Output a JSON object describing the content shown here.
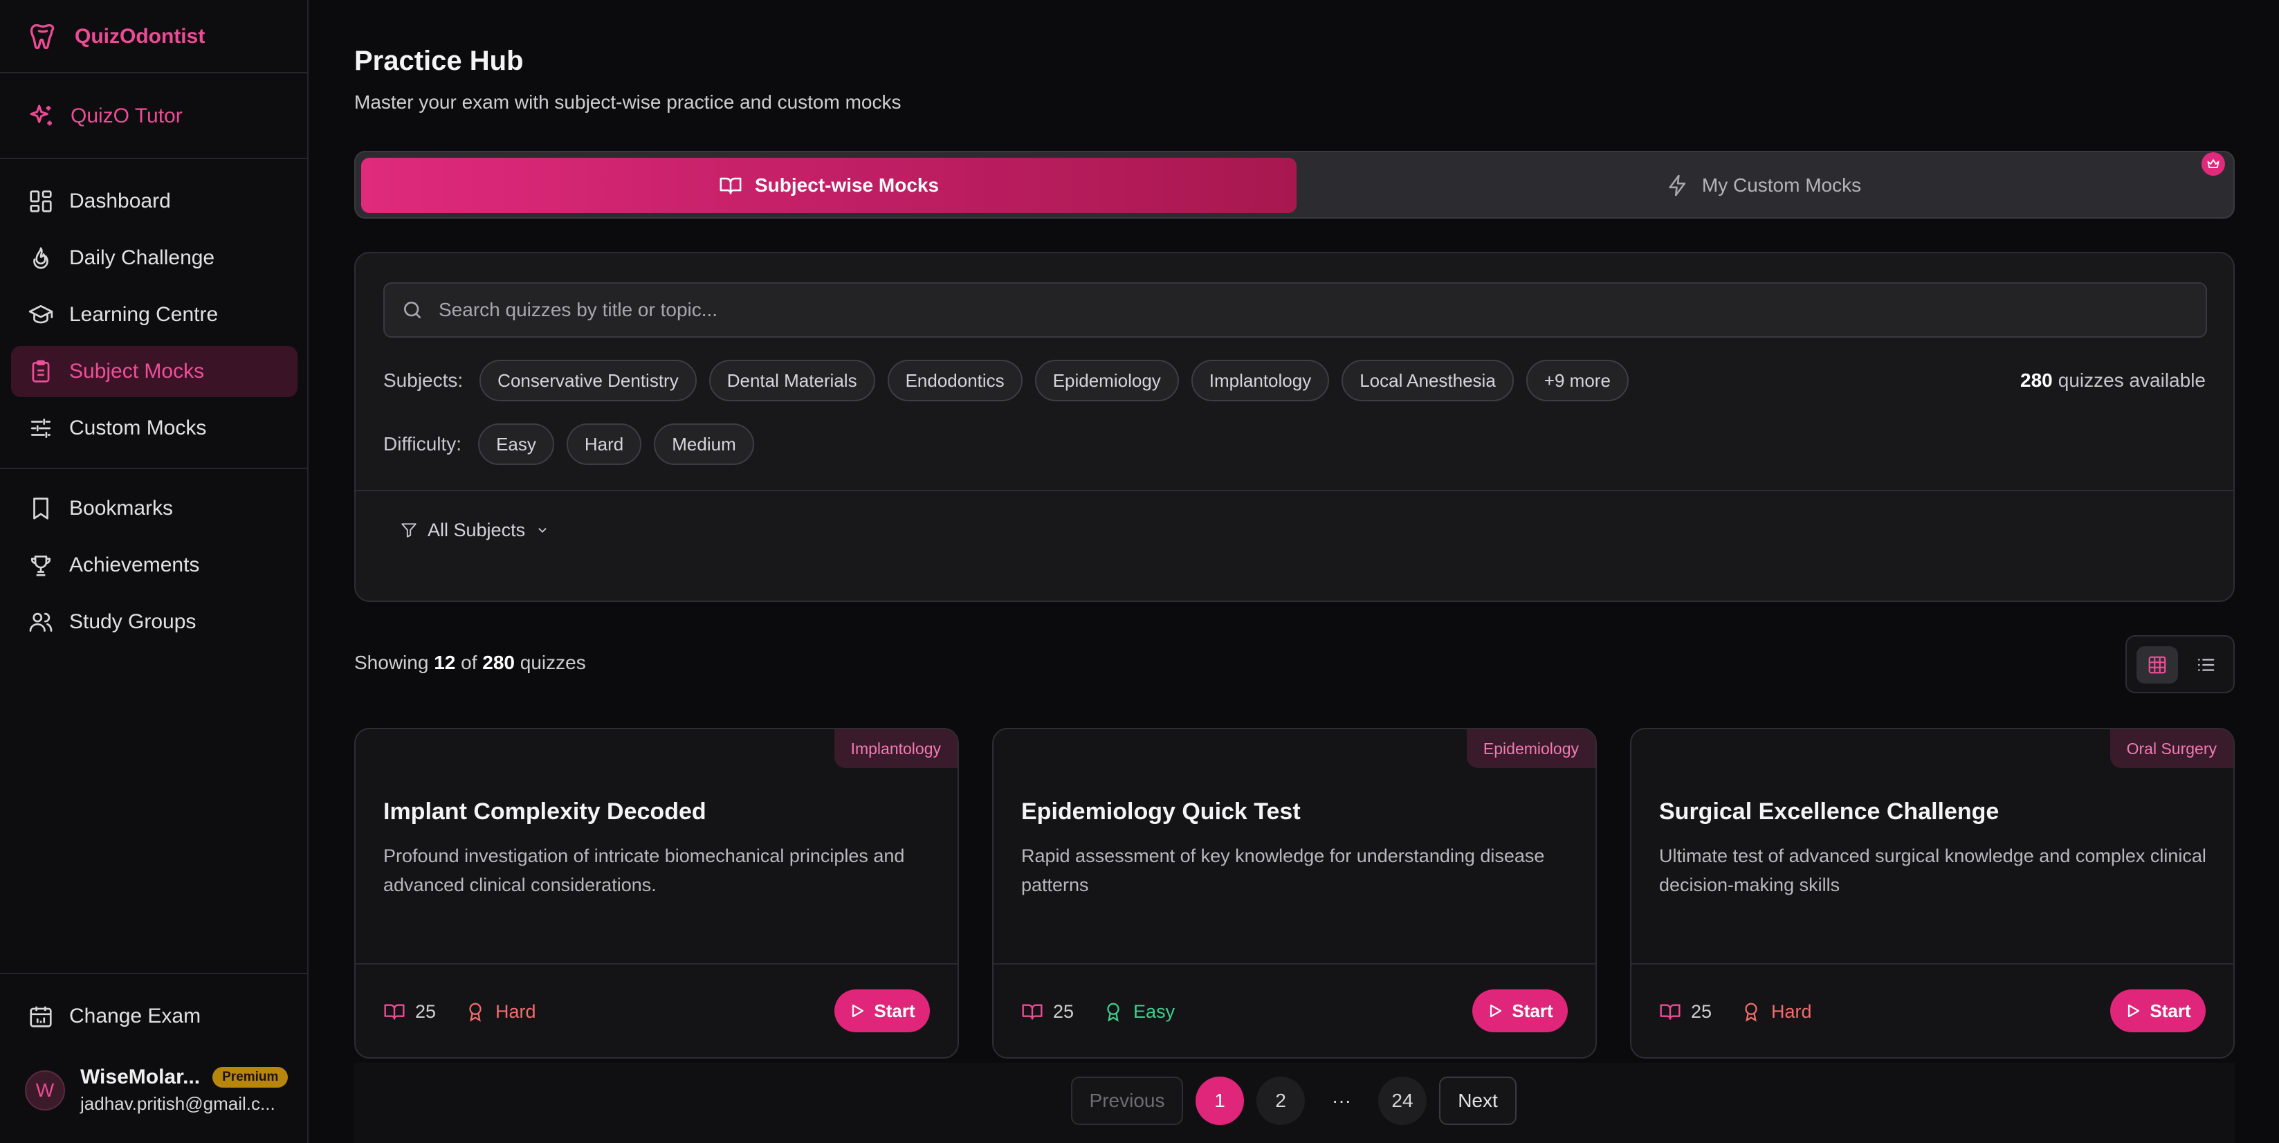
{
  "sidebar": {
    "brand": "QuizOdontist",
    "tutor": "QuizO Tutor",
    "nav_main": [
      {
        "label": "Dashboard",
        "icon": "dashboard-icon"
      },
      {
        "label": "Daily Challenge",
        "icon": "flame-icon"
      },
      {
        "label": "Learning Centre",
        "icon": "graduation-cap-icon"
      },
      {
        "label": "Subject Mocks",
        "icon": "clipboard-icon",
        "active": true
      },
      {
        "label": "Custom Mocks",
        "icon": "sliders-icon"
      }
    ],
    "nav_secondary": [
      {
        "label": "Bookmarks",
        "icon": "bookmark-icon"
      },
      {
        "label": "Achievements",
        "icon": "trophy-icon"
      },
      {
        "label": "Study Groups",
        "icon": "users-icon"
      }
    ],
    "change_exam": "Change Exam",
    "user": {
      "initial": "W",
      "name": "WiseMolar...",
      "badge": "Premium",
      "email": "jadhav.pritish@gmail.c..."
    }
  },
  "header": {
    "title": "Practice Hub",
    "subtitle": "Master your exam with subject-wise practice and custom mocks"
  },
  "tabs": {
    "active": "Subject-wise Mocks",
    "other": "My Custom Mocks"
  },
  "filters": {
    "search_placeholder": "Search quizzes by title or topic...",
    "subjects_label": "Subjects:",
    "subjects": [
      "Conservative Dentistry",
      "Dental Materials",
      "Endodontics",
      "Epidemiology",
      "Implantology",
      "Local Anesthesia",
      "+9 more"
    ],
    "available_count": "280",
    "available_suffix": "quizzes available",
    "difficulty_label": "Difficulty:",
    "difficulties": [
      "Easy",
      "Hard",
      "Medium"
    ],
    "all_subjects": "All Subjects"
  },
  "results": {
    "prefix": "Showing",
    "shown": "12",
    "of": "of",
    "total": "280",
    "suffix": "quizzes"
  },
  "cards": [
    {
      "tag": "Implantology",
      "title": "Implant Complexity Decoded",
      "desc": "Profound investigation of intricate biomechanical principles and advanced clinical considerations.",
      "questions": "25",
      "difficulty": "Hard",
      "start": "Start"
    },
    {
      "tag": "Epidemiology",
      "title": "Epidemiology Quick Test",
      "desc": "Rapid assessment of key knowledge for understanding disease patterns",
      "questions": "25",
      "difficulty": "Easy",
      "start": "Start"
    },
    {
      "tag": "Oral Surgery",
      "title": "Surgical Excellence Challenge",
      "desc": "Ultimate test of advanced surgical knowledge and complex clinical decision-making skills",
      "questions": "25",
      "difficulty": "Hard",
      "start": "Start"
    }
  ],
  "pagination": {
    "previous": "Previous",
    "pages": [
      "1",
      "2",
      "···",
      "24"
    ],
    "current": "1",
    "next": "Next"
  },
  "colors": {
    "accent": "#e0267a",
    "hard": "#f16d6d",
    "easy": "#3ecf8e"
  }
}
